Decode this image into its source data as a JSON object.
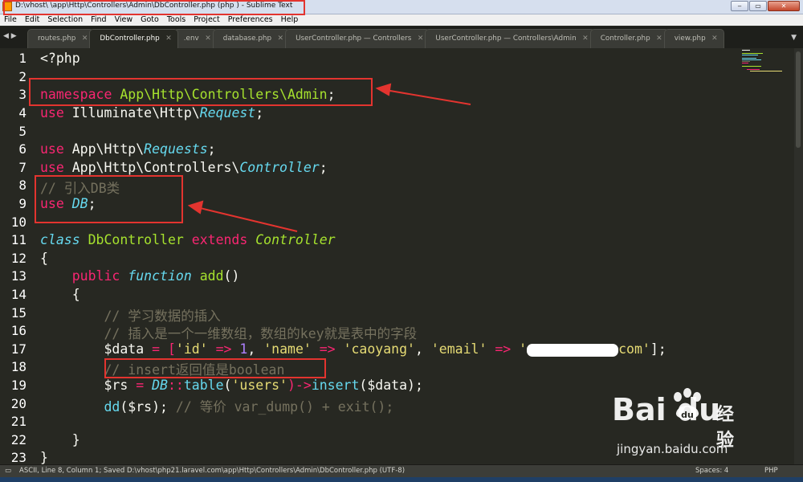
{
  "window": {
    "title": "D:\\vhost\\              \\app\\Http\\Controllers\\Admin\\DbController.php (php              ) - Sublime Text",
    "buttons": [
      "‒",
      "▭",
      "✕"
    ]
  },
  "menu": [
    "File",
    "Edit",
    "Selection",
    "Find",
    "View",
    "Goto",
    "Tools",
    "Project",
    "Preferences",
    "Help"
  ],
  "tab_nav": "◀ ▶",
  "tabs": [
    {
      "label": "routes.php",
      "active": false
    },
    {
      "label": "DbController.php",
      "active": true
    },
    {
      "label": ".env",
      "active": false
    },
    {
      "label": "database.php",
      "active": false
    },
    {
      "label": "UserController.php — Controllers",
      "active": false
    },
    {
      "label": "UserController.php — Controllers\\Admin",
      "active": false
    },
    {
      "label": "Controller.php",
      "active": false
    },
    {
      "label": "view.php",
      "active": false
    }
  ],
  "tab_close": "✕",
  "tab_menu": "▼",
  "line_numbers": [
    "1",
    "2",
    "3",
    "4",
    "5",
    "6",
    "7",
    "8",
    "9",
    "10",
    "11",
    "12",
    "13",
    "14",
    "15",
    "16",
    "17",
    "18",
    "19",
    "20",
    "21",
    "22",
    "23"
  ],
  "current_line": 8,
  "code": {
    "l1": [
      "<?php"
    ],
    "l3": [
      "namespace",
      " App\\Http\\Controllers\\Admin",
      ";"
    ],
    "l4": [
      "use",
      " Illuminate\\Http\\",
      "Request",
      ";"
    ],
    "l6": [
      "use",
      " App\\Http\\",
      "Requests",
      ";"
    ],
    "l7": [
      "use",
      " App\\Http\\Controllers\\",
      "Controller",
      ";"
    ],
    "l8": [
      "// 引入DB类"
    ],
    "l9": [
      "use",
      " ",
      "DB",
      ";"
    ],
    "l11": [
      "class",
      " ",
      "DbController",
      " ",
      "extends",
      " ",
      "Controller"
    ],
    "l12": [
      "{"
    ],
    "l13": [
      "    ",
      "public",
      " ",
      "function",
      " ",
      "add",
      "()"
    ],
    "l14": [
      "    {"
    ],
    "l15": [
      "        // 学习数据的插入"
    ],
    "l16": [
      "        // 插入是一个一维数组，数组的key就是表中的字段"
    ],
    "l17": [
      "        $data",
      " = [",
      "'id'",
      " => ",
      "1",
      ", ",
      "'name'",
      " => ",
      "'caoyang'",
      ", ",
      "'email'",
      " => ",
      "'",
      "com'",
      "];"
    ],
    "l18": [
      "        // insert返回值是boolean"
    ],
    "l19": [
      "        $rs",
      " = ",
      "DB",
      "::",
      "table",
      "(",
      "'users'",
      ")->",
      "insert",
      "($data);"
    ],
    "l20": [
      "        dd",
      "($rs); ",
      "// 等价 var_dump() + exit();"
    ],
    "l22": [
      "    }"
    ],
    "l23": [
      "}"
    ]
  },
  "status": {
    "left": "ASCII, Line 8, Column 1; Saved D:\\vhost\\php21.laravel.com\\app\\Http\\Controllers\\Admin\\DbController.php (UTF-8)",
    "spaces": "Spaces: 4",
    "syntax": "PHP"
  },
  "watermark": {
    "brand": "Bai  du",
    "cn": "经验",
    "url": "jingyan.baidu.com"
  },
  "colors": {
    "background": "#272822",
    "keyword": "#f92672",
    "string": "#e6db74",
    "number": "#ae81ff",
    "function": "#a6e22e",
    "type": "#66d9ef",
    "comment": "#75715e",
    "annotation": "#e3342f"
  },
  "icons": [
    "sublime-text-icon",
    "minimize-icon",
    "maximize-icon",
    "close-icon",
    "tab-nav-icon",
    "tab-close-icon",
    "tab-menu-icon",
    "paw-icon"
  ]
}
